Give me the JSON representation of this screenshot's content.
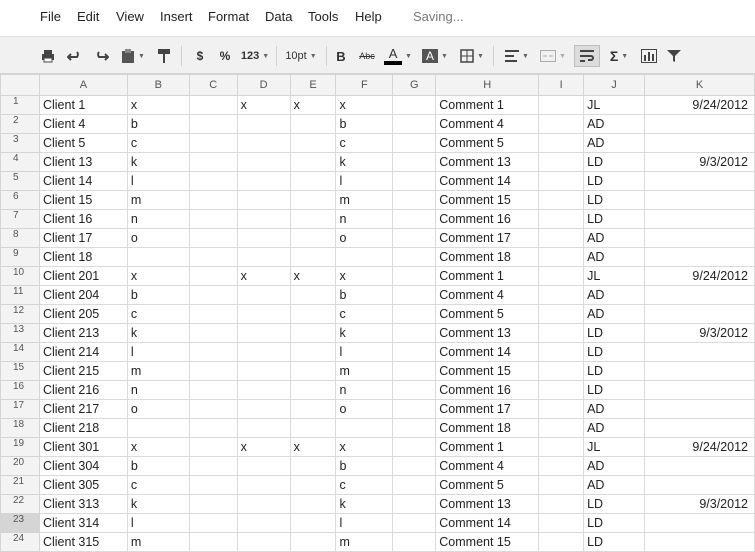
{
  "menu": {
    "items": [
      "File",
      "Edit",
      "View",
      "Insert",
      "Format",
      "Data",
      "Tools",
      "Help"
    ],
    "status": "Saving..."
  },
  "toolbar": {
    "currency_label": "$",
    "percent_label": "%",
    "number_format_label": "123",
    "font_size": "10pt",
    "bold_label": "B",
    "strikethrough_label": "Abc",
    "text_color_label": "A",
    "fill_color_label": "A",
    "text_color": "#000000",
    "sum_label": "Σ"
  },
  "sheet": {
    "columns": [
      "A",
      "B",
      "C",
      "D",
      "E",
      "F",
      "G",
      "H",
      "I",
      "J",
      "K"
    ],
    "active_row": "23",
    "rows": [
      {
        "n": "1",
        "a": "Client 1",
        "b": "x",
        "c": "",
        "d": "x",
        "e": "x",
        "f": "x",
        "g": "",
        "h": "Comment 1",
        "i": "",
        "j": "JL",
        "k": "9/24/2012"
      },
      {
        "n": "2",
        "a": "Client 4",
        "b": "b",
        "c": "",
        "d": "",
        "e": "",
        "f": "b",
        "g": "",
        "h": "Comment 4",
        "i": "",
        "j": "AD",
        "k": ""
      },
      {
        "n": "3",
        "a": "Client 5",
        "b": "c",
        "c": "",
        "d": "",
        "e": "",
        "f": "c",
        "g": "",
        "h": "Comment 5",
        "i": "",
        "j": "AD",
        "k": ""
      },
      {
        "n": "4",
        "a": "Client 13",
        "b": "k",
        "c": "",
        "d": "",
        "e": "",
        "f": "k",
        "g": "",
        "h": "Comment 13",
        "i": "",
        "j": "LD",
        "k": "9/3/2012"
      },
      {
        "n": "5",
        "a": "Client 14",
        "b": "l",
        "c": "",
        "d": "",
        "e": "",
        "f": "l",
        "g": "",
        "h": "Comment 14",
        "i": "",
        "j": "LD",
        "k": ""
      },
      {
        "n": "6",
        "a": "Client 15",
        "b": "m",
        "c": "",
        "d": "",
        "e": "",
        "f": "m",
        "g": "",
        "h": "Comment 15",
        "i": "",
        "j": "LD",
        "k": ""
      },
      {
        "n": "7",
        "a": "Client 16",
        "b": "n",
        "c": "",
        "d": "",
        "e": "",
        "f": "n",
        "g": "",
        "h": "Comment 16",
        "i": "",
        "j": "LD",
        "k": ""
      },
      {
        "n": "8",
        "a": "Client 17",
        "b": "o",
        "c": "",
        "d": "",
        "e": "",
        "f": "o",
        "g": "",
        "h": "Comment 17",
        "i": "",
        "j": "AD",
        "k": ""
      },
      {
        "n": "9",
        "a": "Client 18",
        "b": "",
        "c": "",
        "d": "",
        "e": "",
        "f": "",
        "g": "",
        "h": "Comment 18",
        "i": "",
        "j": "AD",
        "k": ""
      },
      {
        "n": "10",
        "a": "Client 201",
        "b": "x",
        "c": "",
        "d": "x",
        "e": "x",
        "f": "x",
        "g": "",
        "h": "Comment 1",
        "i": "",
        "j": "JL",
        "k": "9/24/2012"
      },
      {
        "n": "11",
        "a": "Client 204",
        "b": "b",
        "c": "",
        "d": "",
        "e": "",
        "f": "b",
        "g": "",
        "h": "Comment 4",
        "i": "",
        "j": "AD",
        "k": ""
      },
      {
        "n": "12",
        "a": "Client 205",
        "b": "c",
        "c": "",
        "d": "",
        "e": "",
        "f": "c",
        "g": "",
        "h": "Comment 5",
        "i": "",
        "j": "AD",
        "k": ""
      },
      {
        "n": "13",
        "a": "Client 213",
        "b": "k",
        "c": "",
        "d": "",
        "e": "",
        "f": "k",
        "g": "",
        "h": "Comment 13",
        "i": "",
        "j": "LD",
        "k": "9/3/2012"
      },
      {
        "n": "14",
        "a": "Client 214",
        "b": "l",
        "c": "",
        "d": "",
        "e": "",
        "f": "l",
        "g": "",
        "h": "Comment 14",
        "i": "",
        "j": "LD",
        "k": ""
      },
      {
        "n": "15",
        "a": "Client 215",
        "b": "m",
        "c": "",
        "d": "",
        "e": "",
        "f": "m",
        "g": "",
        "h": "Comment 15",
        "i": "",
        "j": "LD",
        "k": ""
      },
      {
        "n": "16",
        "a": "Client 216",
        "b": "n",
        "c": "",
        "d": "",
        "e": "",
        "f": "n",
        "g": "",
        "h": "Comment 16",
        "i": "",
        "j": "LD",
        "k": ""
      },
      {
        "n": "17",
        "a": "Client 217",
        "b": "o",
        "c": "",
        "d": "",
        "e": "",
        "f": "o",
        "g": "",
        "h": "Comment 17",
        "i": "",
        "j": "AD",
        "k": ""
      },
      {
        "n": "18",
        "a": "Client 218",
        "b": "",
        "c": "",
        "d": "",
        "e": "",
        "f": "",
        "g": "",
        "h": "Comment 18",
        "i": "",
        "j": "AD",
        "k": ""
      },
      {
        "n": "19",
        "a": "Client 301",
        "b": "x",
        "c": "",
        "d": "x",
        "e": "x",
        "f": "x",
        "g": "",
        "h": "Comment 1",
        "i": "",
        "j": "JL",
        "k": "9/24/2012"
      },
      {
        "n": "20",
        "a": "Client 304",
        "b": "b",
        "c": "",
        "d": "",
        "e": "",
        "f": "b",
        "g": "",
        "h": "Comment 4",
        "i": "",
        "j": "AD",
        "k": ""
      },
      {
        "n": "21",
        "a": "Client 305",
        "b": "c",
        "c": "",
        "d": "",
        "e": "",
        "f": "c",
        "g": "",
        "h": "Comment 5",
        "i": "",
        "j": "AD",
        "k": ""
      },
      {
        "n": "22",
        "a": "Client 313",
        "b": "k",
        "c": "",
        "d": "",
        "e": "",
        "f": "k",
        "g": "",
        "h": "Comment 13",
        "i": "",
        "j": "LD",
        "k": "9/3/2012"
      },
      {
        "n": "23",
        "a": "Client 314",
        "b": "l",
        "c": "",
        "d": "",
        "e": "",
        "f": "l",
        "g": "",
        "h": "Comment 14",
        "i": "",
        "j": "LD",
        "k": ""
      },
      {
        "n": "24",
        "a": "Client 315",
        "b": "m",
        "c": "",
        "d": "",
        "e": "",
        "f": "m",
        "g": "",
        "h": "Comment 15",
        "i": "",
        "j": "LD",
        "k": ""
      }
    ]
  }
}
